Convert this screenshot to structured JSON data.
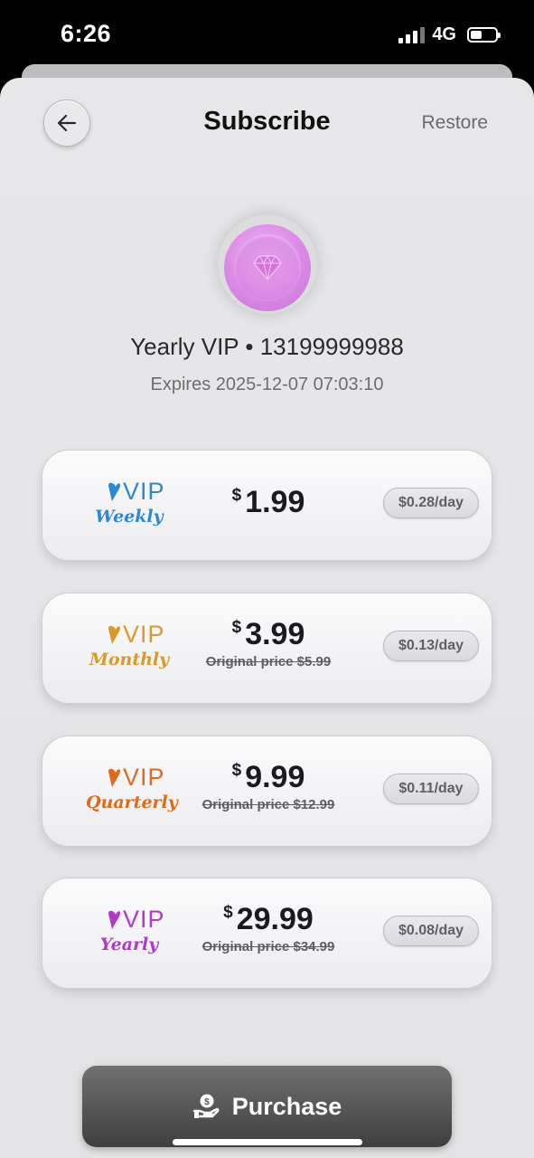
{
  "status_bar": {
    "time": "6:26",
    "network": "4G",
    "battery_level": 0.4,
    "signal_bars": 3
  },
  "header": {
    "title": "Subscribe",
    "restore_label": "Restore"
  },
  "account": {
    "vip_line": "Yearly VIP • 13199999988",
    "expires": "Expires 2025-12-07 07:03:10",
    "icon": "diamond-icon"
  },
  "plans": [
    {
      "name": "Weekly",
      "vip": "VIP",
      "color": "#2f86d2",
      "currency": "$",
      "price": "1.99",
      "original": "",
      "per_day": "$0.28/day"
    },
    {
      "name": "Monthly",
      "vip": "VIP",
      "color": "#d99a2a",
      "currency": "$",
      "price": "3.99",
      "original": "Original price $5.99",
      "per_day": "$0.13/day"
    },
    {
      "name": "Quarterly",
      "vip": "VIP",
      "color": "#de6a1e",
      "currency": "$",
      "price": "9.99",
      "original": "Original price $12.99",
      "per_day": "$0.11/day"
    },
    {
      "name": "Yearly",
      "vip": "VIP",
      "color": "#b03ac8",
      "currency": "$",
      "price": "29.99",
      "original": "Original price $34.99",
      "per_day": "$0.08/day"
    }
  ],
  "purchase": {
    "label": "Purchase",
    "icon": "money-hand-icon"
  },
  "colors": {
    "background": "#e6e6e8",
    "button": "#4a4a4a",
    "text": "#111111"
  }
}
